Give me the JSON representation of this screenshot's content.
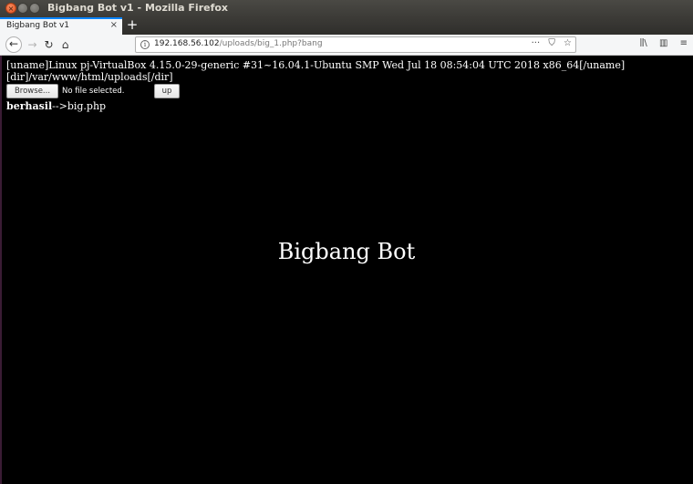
{
  "window": {
    "title": "Bigbang Bot v1 - Mozilla Firefox"
  },
  "tabs": [
    {
      "label": "Bigbang Bot v1",
      "close": "×"
    }
  ],
  "toolbar": {
    "new_tab": "+",
    "back": "←",
    "forward": "→",
    "reload": "↻",
    "home": "⌂",
    "url_host": "192.168.56.102",
    "url_path": "/uploads/big_1.php?bang",
    "page_actions": "···",
    "pocket": "⛉",
    "bookmark": "☆",
    "library": "⫼\\",
    "sidebar": "▥",
    "menu": "≡"
  },
  "page": {
    "uname": "[uname]Linux pj-VirtualBox 4.15.0-29-generic #31~16.04.1-Ubuntu SMP Wed Jul 18 08:54:04 UTC 2018 x86_64[/uname]",
    "dir": "[dir]/var/www/html/uploads[/dir]",
    "browse_label": "Browse...",
    "file_status": "No file selected.",
    "upload_label": "up",
    "result_label": "berhasil",
    "result_arrow": "-->",
    "result_file": "big.php",
    "heading": "Bigbang Bot"
  },
  "colors": {
    "page_background": "#000000",
    "text": "#ffffff",
    "accent": "#0a84ff"
  }
}
